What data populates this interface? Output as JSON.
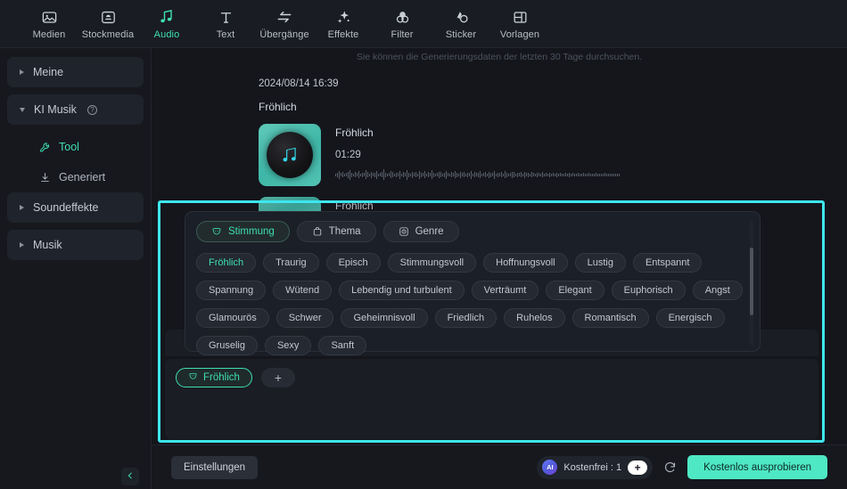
{
  "toolbar": {
    "items": [
      {
        "label": "Medien",
        "icon": "media-icon",
        "active": false
      },
      {
        "label": "Stockmedia",
        "icon": "stockmedia-icon",
        "active": false
      },
      {
        "label": "Audio",
        "icon": "audio-icon",
        "active": true
      },
      {
        "label": "Text",
        "icon": "text-icon",
        "active": false
      },
      {
        "label": "Übergänge",
        "icon": "transitions-icon",
        "active": false
      },
      {
        "label": "Effekte",
        "icon": "effects-icon",
        "active": false
      },
      {
        "label": "Filter",
        "icon": "filter-icon",
        "active": false
      },
      {
        "label": "Sticker",
        "icon": "sticker-icon",
        "active": false
      },
      {
        "label": "Vorlagen",
        "icon": "templates-icon",
        "active": false
      }
    ]
  },
  "sidebar": {
    "groups": [
      {
        "label": "Meine",
        "expanded": false,
        "help": false
      },
      {
        "label": "KI Musik",
        "expanded": true,
        "help": true
      },
      {
        "label": "Soundeffekte",
        "expanded": false,
        "help": false
      },
      {
        "label": "Musik",
        "expanded": false,
        "help": false
      }
    ],
    "sub_items": [
      {
        "label": "Tool",
        "icon": "wrench-icon",
        "active": true
      },
      {
        "label": "Generiert",
        "icon": "download-icon",
        "active": false
      }
    ],
    "collapse_icon": "chevron-left-icon"
  },
  "main": {
    "hint": "Sie können die Generierungsdaten der letzten 30 Tage durchsuchen.",
    "history": {
      "date": "2024/08/14 16:39",
      "prompt": "Fröhlich",
      "track": {
        "title": "Fröhlich",
        "duration": "01:29",
        "thumb_icon": "music-note-icon"
      }
    }
  },
  "tag_panel": {
    "categories": [
      {
        "label": "Stimmung",
        "icon": "mask-icon",
        "active": true
      },
      {
        "label": "Thema",
        "icon": "bag-icon",
        "active": false
      },
      {
        "label": "Genre",
        "icon": "disc-icon",
        "active": false
      }
    ],
    "rows": [
      [
        "Fröhlich",
        "Traurig",
        "Episch",
        "Stimmungsvoll",
        "Hoffnungsvoll",
        "Lustig",
        "Entspannt"
      ],
      [
        "Spannung",
        "Wütend",
        "Lebendig und turbulent",
        "Verträumt",
        "Elegant",
        "Euphorisch",
        "Angst"
      ],
      [
        "Glamourös",
        "Schwer",
        "Geheimnisvoll",
        "Friedlich",
        "Ruhelos",
        "Romantisch",
        "Energisch"
      ],
      [
        "Gruselig",
        "Sexy",
        "Sanft"
      ]
    ],
    "selected_tag": "Fröhlich"
  },
  "selection": {
    "chip": {
      "label": "Fröhlich",
      "icon": "mask-icon"
    },
    "add_label": "+"
  },
  "bottom": {
    "settings_label": "Einstellungen",
    "ai_badge": "AI",
    "credit_text": "Kostenfrei : 1",
    "plus_label": "+",
    "refresh_icon": "refresh-icon",
    "try_label": "Kostenlos ausprobieren"
  },
  "colors": {
    "accent_teal": "#3fdfb2",
    "highlight_cyan": "#3ee6ee",
    "cta_green": "#4ee8c4",
    "bg": "#14161c"
  }
}
